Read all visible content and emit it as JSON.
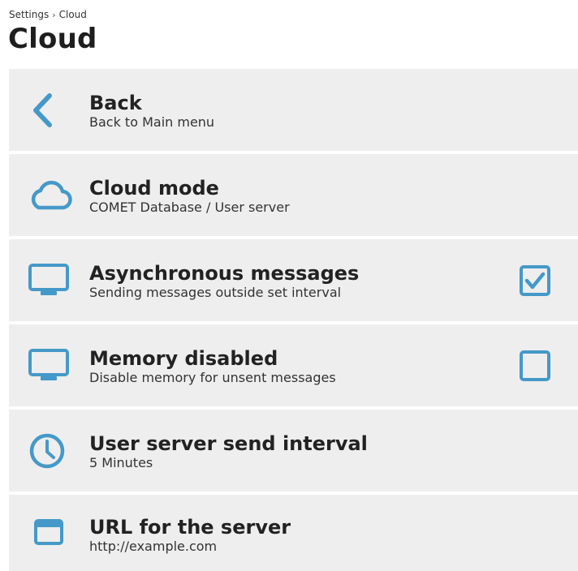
{
  "breadcrumb": {
    "parent": "Settings",
    "separator": "›",
    "current": "Cloud"
  },
  "page": {
    "title": "Cloud"
  },
  "colors": {
    "accent": "#4599c8",
    "item_background": "#eeeeee",
    "title_text": "#1e1e1e"
  },
  "menu": {
    "items": [
      {
        "icon": "chevron-left-icon",
        "title": "Back",
        "subtitle": "Back to Main menu"
      },
      {
        "icon": "cloud-icon",
        "title": "Cloud mode",
        "subtitle": "COMET Database / User server"
      },
      {
        "icon": "monitor-icon",
        "title": "Asynchronous messages",
        "subtitle": "Sending messages outside set interval",
        "checked": true
      },
      {
        "icon": "monitor-icon",
        "title": "Memory disabled",
        "subtitle": "Disable memory for unsent messages",
        "checked": false
      },
      {
        "icon": "clock-icon",
        "title": "User server send interval",
        "subtitle": "5 Minutes"
      },
      {
        "icon": "window-icon",
        "title": "URL for the server",
        "subtitle": "http://example.com"
      }
    ]
  }
}
